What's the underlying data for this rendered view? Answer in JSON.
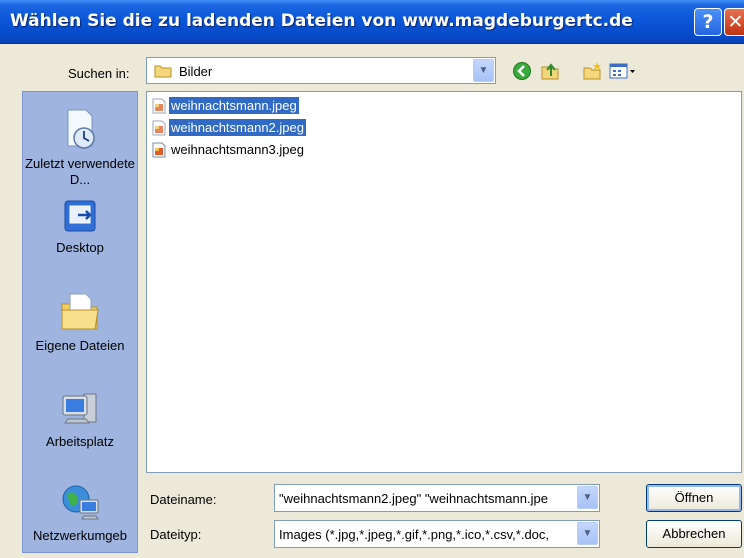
{
  "window": {
    "title": "Wählen Sie die zu ladenden Dateien von www.magdeburgertc.de",
    "help_label": "?",
    "close_label": "✕"
  },
  "lookin": {
    "label": "Suchen in:",
    "value": "Bilder"
  },
  "toolbar": {
    "icons": [
      "back-icon",
      "up-folder-icon",
      "new-folder-icon",
      "view-menu-icon"
    ]
  },
  "places": [
    {
      "label": "Zuletzt verwendete D...",
      "icon": "recent-documents-icon"
    },
    {
      "label": "Desktop",
      "icon": "desktop-icon"
    },
    {
      "label": "Eigene Dateien",
      "icon": "my-documents-icon"
    },
    {
      "label": "Arbeitsplatz",
      "icon": "my-computer-icon"
    },
    {
      "label": "Netzwerkumgeb",
      "icon": "network-icon"
    }
  ],
  "files": [
    {
      "name": "weihnachtsmann.jpeg",
      "selected": true
    },
    {
      "name": "weihnachtsmann2.jpeg",
      "selected": true
    },
    {
      "name": "weihnachtsmann3.jpeg",
      "selected": false
    }
  ],
  "filename": {
    "label": "Dateiname:",
    "value": "\"weihnachtsmann2.jpeg\" \"weihnachtsmann.jpe"
  },
  "filetype": {
    "label": "Dateityp:",
    "value": "Images (*.jpg,*.jpeg,*.gif,*.png,*.ico,*.csv,*.doc,"
  },
  "buttons": {
    "open": "Öffnen",
    "cancel": "Abbrechen"
  },
  "colors": {
    "titlebar": "#0a55d8",
    "selection": "#316ac5",
    "places_bg": "#9fb4de",
    "dialog_bg": "#ece9d8"
  }
}
